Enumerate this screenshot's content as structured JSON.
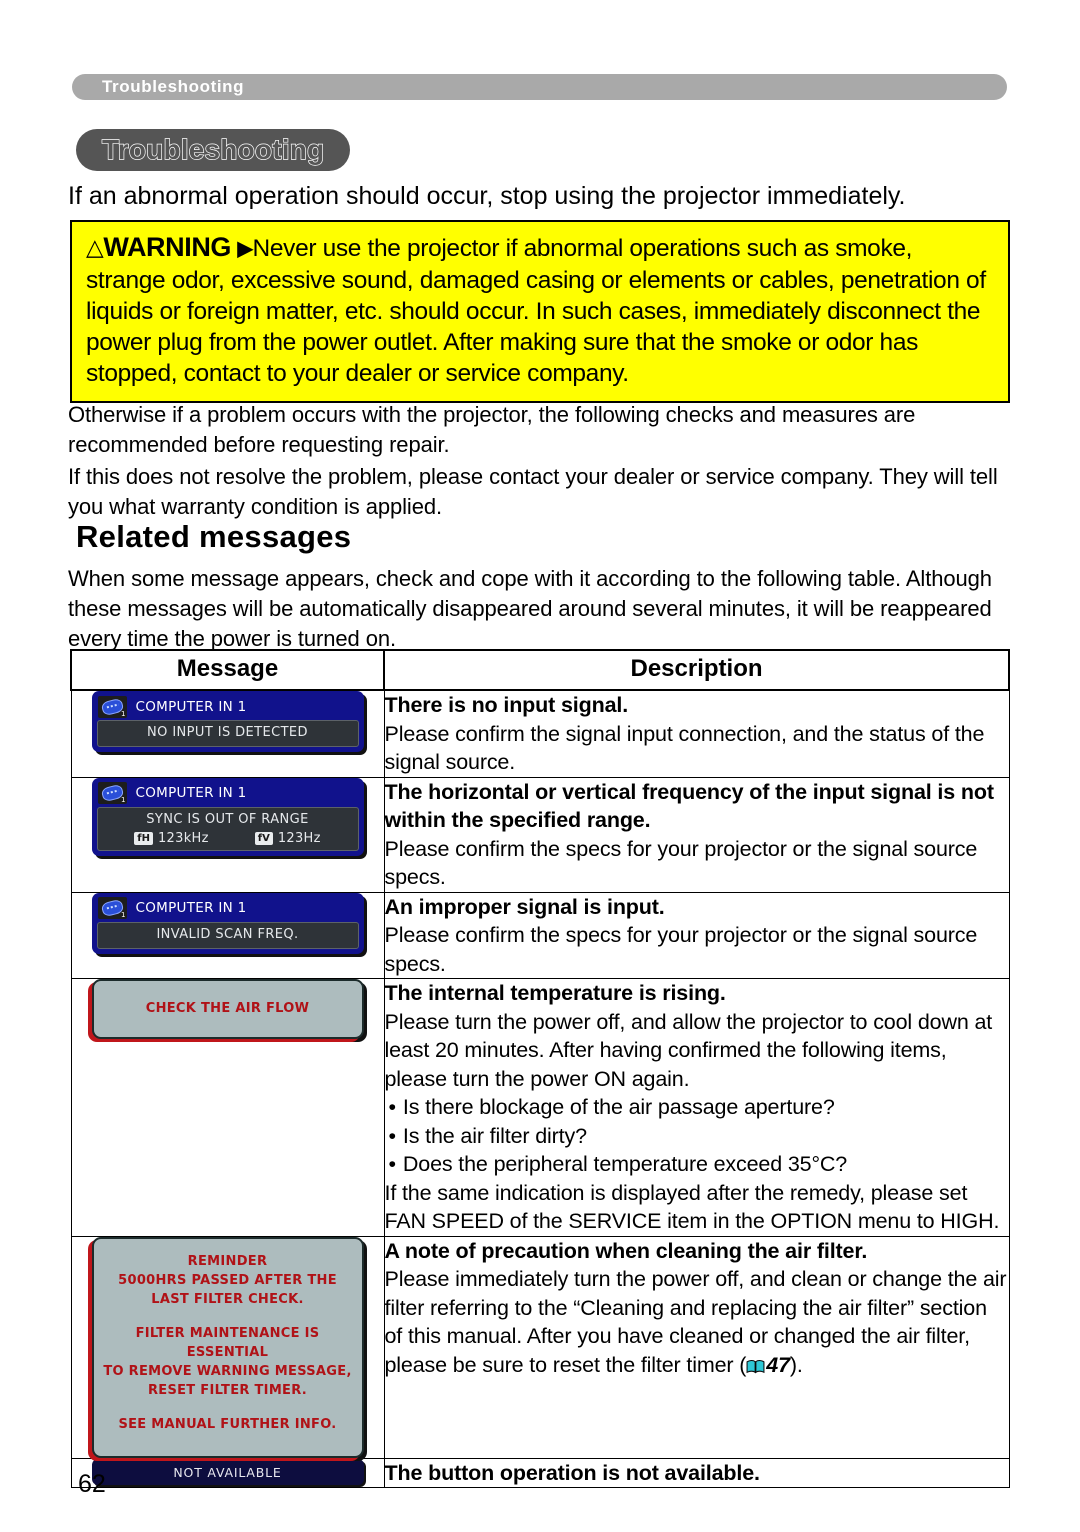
{
  "running_header": "Troubleshooting",
  "chapter_title": "Troubleshooting",
  "lead_line": "If an abnormal operation should occur, stop using the projector immediately.",
  "warning": {
    "triangle_icon": "warning-triangle-icon",
    "label": "WARNING",
    "arrow": "▶",
    "body": "Never use the projector if abnormal operations such as smoke, strange odor, excessive sound, damaged casing or elements or cables, penetration of liquids or foreign matter, etc. should occur. In such cases, immediately disconnect the power plug from the power outlet. After making sure that the smoke or odor has stopped, contact to your dealer or service company.",
    "background_color": "#ffff00"
  },
  "paragraphs": {
    "p1": "Otherwise if a problem occurs with the projector, the following checks and measures are recommended before requesting repair.",
    "p2": "If this does not resolve the problem, please contact your dealer or service company. They will tell you what warranty condition is applied.",
    "p3": "When some message appears, check and cope with it according to the following table. Although these messages will be automatically disappeared around several minutes, it will be reappeared every time the power is turned on."
  },
  "section_heading": "Related messages",
  "table": {
    "headers": {
      "message": "Message",
      "description": "Description"
    },
    "rows": [
      {
        "osd": {
          "type": "blue",
          "icon": "computer-input-connector-icon",
          "title": "COMPUTER IN 1",
          "panel_line": "NO INPUT IS DETECTED"
        },
        "desc_title": "There is no input signal.",
        "desc_body": "Please confirm the signal input connection, and the status of the signal source."
      },
      {
        "osd": {
          "type": "blue-freq",
          "icon": "computer-input-connector-icon",
          "title": "COMPUTER IN 1",
          "panel_line": "SYNC IS OUT OF RANGE",
          "f_h_tag": "fH",
          "f_h_value": "123kHz",
          "f_v_tag": "fV",
          "f_v_value": "123Hz"
        },
        "desc_title": "The horizontal or vertical frequency of the input signal is not within the specified range.",
        "desc_body": "Please confirm the specs for your projector or the signal source specs."
      },
      {
        "osd": {
          "type": "blue",
          "icon": "computer-input-connector-icon",
          "title": "COMPUTER IN 1",
          "panel_line": "INVALID SCAN FREQ."
        },
        "desc_title": "An improper signal is input.",
        "desc_body": "Please confirm the specs for your projector or the signal source specs."
      },
      {
        "osd": {
          "type": "plate",
          "lines": [
            "CHECK THE AIR FLOW"
          ]
        },
        "desc_title": "The internal temperature is rising.",
        "desc_body": "Please turn the power off, and allow the projector to cool down at least 20 minutes. After having confirmed the following items, please turn the power ON again.",
        "desc_bullets": [
          "Is there blockage of the air passage aperture?",
          "Is the air filter dirty?",
          "Does the peripheral temperature exceed 35°C?"
        ],
        "desc_footer": "If the same indication is displayed after the remedy, please set FAN SPEED of the SERVICE item in the OPTION menu to HIGH."
      },
      {
        "osd": {
          "type": "plate",
          "lines": [
            "REMINDER",
            "5000HRS PASSED AFTER THE",
            "LAST FILTER CHECK.",
            "",
            "FILTER MAINTENANCE IS ESSENTIAL",
            "TO REMOVE WARNING MESSAGE,",
            "RESET FILTER TIMER.",
            "",
            "SEE MANUAL FURTHER INFO."
          ]
        },
        "desc_title": "A note of precaution when cleaning the air filter.",
        "desc_body": "Please immediately turn the power off, and clean or change the air filter referring to the “Cleaning and replacing the air filter” section of this manual. After you have cleaned or changed the air filter, please be sure to reset the filter timer (",
        "desc_ref_icon": "book-icon",
        "desc_ref_page": "47",
        "desc_body_end": ")."
      },
      {
        "osd": {
          "type": "bar",
          "text": "NOT AVAILABLE"
        },
        "desc_title": "The button operation is not available."
      }
    ]
  },
  "page_number": "62",
  "colors": {
    "header_band": "#a9a9a9",
    "chapter_pill": "#555555",
    "warning_yellow": "#ffff00",
    "osd_blue": "#11128c",
    "osd_plate_gray": "#adbcbe",
    "osd_plate_red": "#b01217",
    "osd_bar_navy": "#0d0d3f",
    "book_icon_cyan": "#2ec8d6"
  }
}
